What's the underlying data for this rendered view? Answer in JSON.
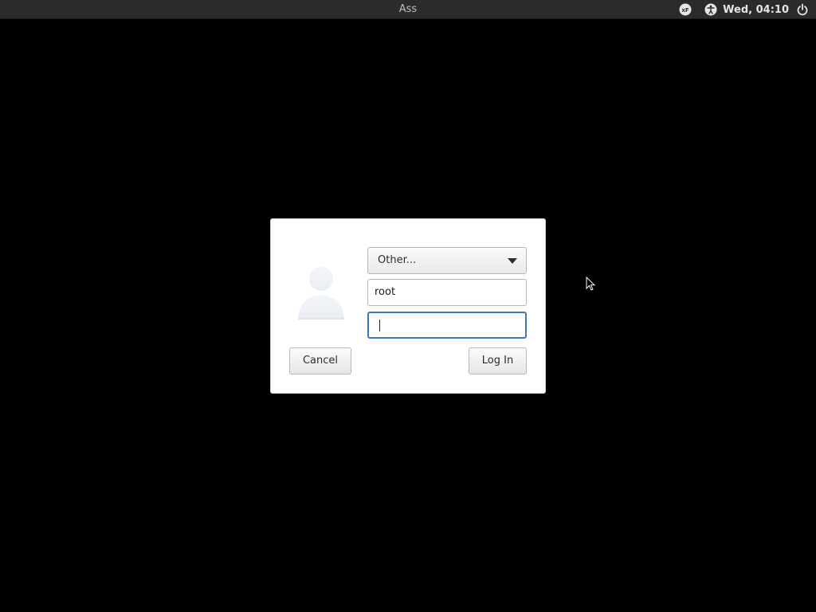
{
  "topbar": {
    "title": "Ass",
    "clock": "Wed, 04:10",
    "icons": [
      "keyboard-layout-icon",
      "accessibility-icon",
      "power-icon"
    ]
  },
  "login_dialog": {
    "user_select": {
      "selected": "Other..."
    },
    "username_field": {
      "value": "root"
    },
    "password_field": {
      "value": ""
    },
    "cancel_label": "Cancel",
    "login_label": "Log In"
  },
  "colors": {
    "topbar_bg": "#2b2b2b",
    "desktop_bg": "#000000",
    "focus_border": "#3d78b4"
  }
}
